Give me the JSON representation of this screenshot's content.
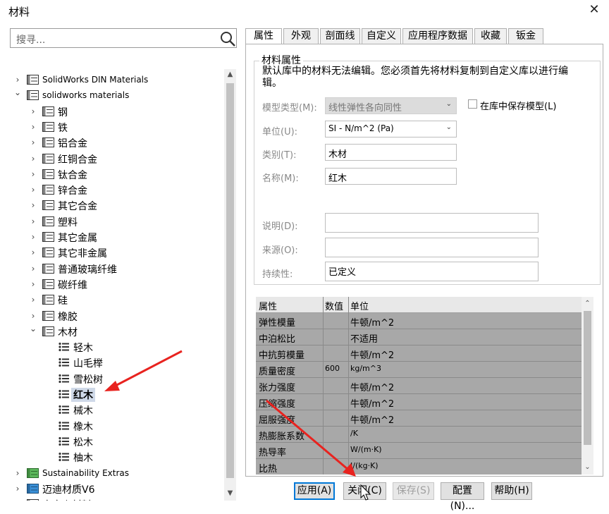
{
  "window": {
    "title": "材料",
    "close_glyph": "✕"
  },
  "search": {
    "placeholder": "搜寻..."
  },
  "tree": {
    "items": [
      {
        "label": "SolidWorks DIN Materials",
        "chev": "›",
        "level": 1,
        "icon": "library-icon"
      },
      {
        "label": "solidworks materials",
        "chev": "⌄",
        "level": 1,
        "icon": "library-icon"
      },
      {
        "label": "钢",
        "chev": "›",
        "level": 2,
        "icon": "category-icon"
      },
      {
        "label": "铁",
        "chev": "›",
        "level": 2,
        "icon": "category-icon"
      },
      {
        "label": "铝合金",
        "chev": "›",
        "level": 2,
        "icon": "category-icon"
      },
      {
        "label": "红铜合金",
        "chev": "›",
        "level": 2,
        "icon": "category-icon"
      },
      {
        "label": "钛合金",
        "chev": "›",
        "level": 2,
        "icon": "category-icon"
      },
      {
        "label": "锌合金",
        "chev": "›",
        "level": 2,
        "icon": "category-icon"
      },
      {
        "label": "其它合金",
        "chev": "›",
        "level": 2,
        "icon": "category-icon"
      },
      {
        "label": "塑料",
        "chev": "›",
        "level": 2,
        "icon": "category-icon"
      },
      {
        "label": "其它金属",
        "chev": "›",
        "level": 2,
        "icon": "category-icon"
      },
      {
        "label": "其它非金属",
        "chev": "›",
        "level": 2,
        "icon": "category-icon"
      },
      {
        "label": "普通玻璃纤维",
        "chev": "›",
        "level": 2,
        "icon": "category-icon"
      },
      {
        "label": "碳纤维",
        "chev": "›",
        "level": 2,
        "icon": "category-icon"
      },
      {
        "label": "硅",
        "chev": "›",
        "level": 2,
        "icon": "category-icon"
      },
      {
        "label": "橡胶",
        "chev": "›",
        "level": 2,
        "icon": "category-icon"
      },
      {
        "label": "木材",
        "chev": "⌄",
        "level": 2,
        "icon": "category-icon"
      },
      {
        "label": "轻木",
        "chev": "",
        "level": 3,
        "icon": "material-icon"
      },
      {
        "label": "山毛榉",
        "chev": "",
        "level": 3,
        "icon": "material-icon"
      },
      {
        "label": "雪松树",
        "chev": "",
        "level": 3,
        "icon": "material-icon"
      },
      {
        "label": "红木",
        "chev": "",
        "level": 3,
        "icon": "material-icon",
        "selected": true
      },
      {
        "label": "械木",
        "chev": "",
        "level": 3,
        "icon": "material-icon"
      },
      {
        "label": "橡木",
        "chev": "",
        "level": 3,
        "icon": "material-icon"
      },
      {
        "label": "松木",
        "chev": "",
        "level": 3,
        "icon": "material-icon"
      },
      {
        "label": "柚木",
        "chev": "",
        "level": 3,
        "icon": "material-icon"
      },
      {
        "label": "Sustainability Extras",
        "chev": "›",
        "level": 1,
        "icon": "library-green-icon"
      },
      {
        "label": "迈迪材质V6",
        "chev": "›",
        "level": 1,
        "icon": "library-blue-icon"
      },
      {
        "label": "自定义材料",
        "chev": "›",
        "level": 1,
        "icon": "library-icon"
      }
    ]
  },
  "tabs": [
    {
      "label": "属性",
      "active": true
    },
    {
      "label": "外观"
    },
    {
      "label": "剖面线"
    },
    {
      "label": "自定义"
    },
    {
      "label": "应用程序数据"
    },
    {
      "label": "收藏"
    },
    {
      "label": "钣金"
    }
  ],
  "material_properties": {
    "group_title": "材料属性",
    "notice": "默认库中的材料无法编辑。您必须首先将材料复制到自定义库以进行编辑。",
    "model_type_label": "模型类型(M):",
    "model_type_value": "线性弹性各向同性",
    "save_model_label": "在库中保存模型(L)",
    "units_label": "单位(U):",
    "units_value": "SI - N/m^2 (Pa)",
    "category_label": "类别(T):",
    "category_value": "木材",
    "name_label": "名称(M):",
    "name_value": "红木",
    "description_label": "说明(D):",
    "description_value": "",
    "source_label": "来源(O):",
    "source_value": "",
    "sustainability_label": "持续性:",
    "sustainability_value": "已定义"
  },
  "property_table": {
    "headers": [
      "属性",
      "数值",
      "单位"
    ],
    "rows": [
      {
        "property": "弹性模量",
        "value": "",
        "unit": "牛顿/m^2"
      },
      {
        "property": "中泊松比",
        "value": "",
        "unit": "不适用"
      },
      {
        "property": "中抗剪模量",
        "value": "",
        "unit": "牛顿/m^2"
      },
      {
        "property": "质量密度",
        "value": "600",
        "unit": "kg/m^3"
      },
      {
        "property": "张力强度",
        "value": "",
        "unit": "牛顿/m^2"
      },
      {
        "property": "压缩强度",
        "value": "",
        "unit": "牛顿/m^2"
      },
      {
        "property": "屈服强度",
        "value": "",
        "unit": "牛顿/m^2"
      },
      {
        "property": "热膨胀系数",
        "value": "",
        "unit": "/K"
      },
      {
        "property": "热导率",
        "value": "",
        "unit": "W/(m·K)"
      },
      {
        "property": "比热",
        "value": "",
        "unit": "J/(kg·K)"
      }
    ]
  },
  "buttons": {
    "apply": "应用(A)",
    "close": "关闭(C)",
    "save": "保存(S)",
    "config": "配置(N)...",
    "help": "帮助(H)"
  },
  "colors": {
    "accent": "#0078d7",
    "annotation_arrow": "#e8231f",
    "table_bg": "#a8a8a8"
  }
}
